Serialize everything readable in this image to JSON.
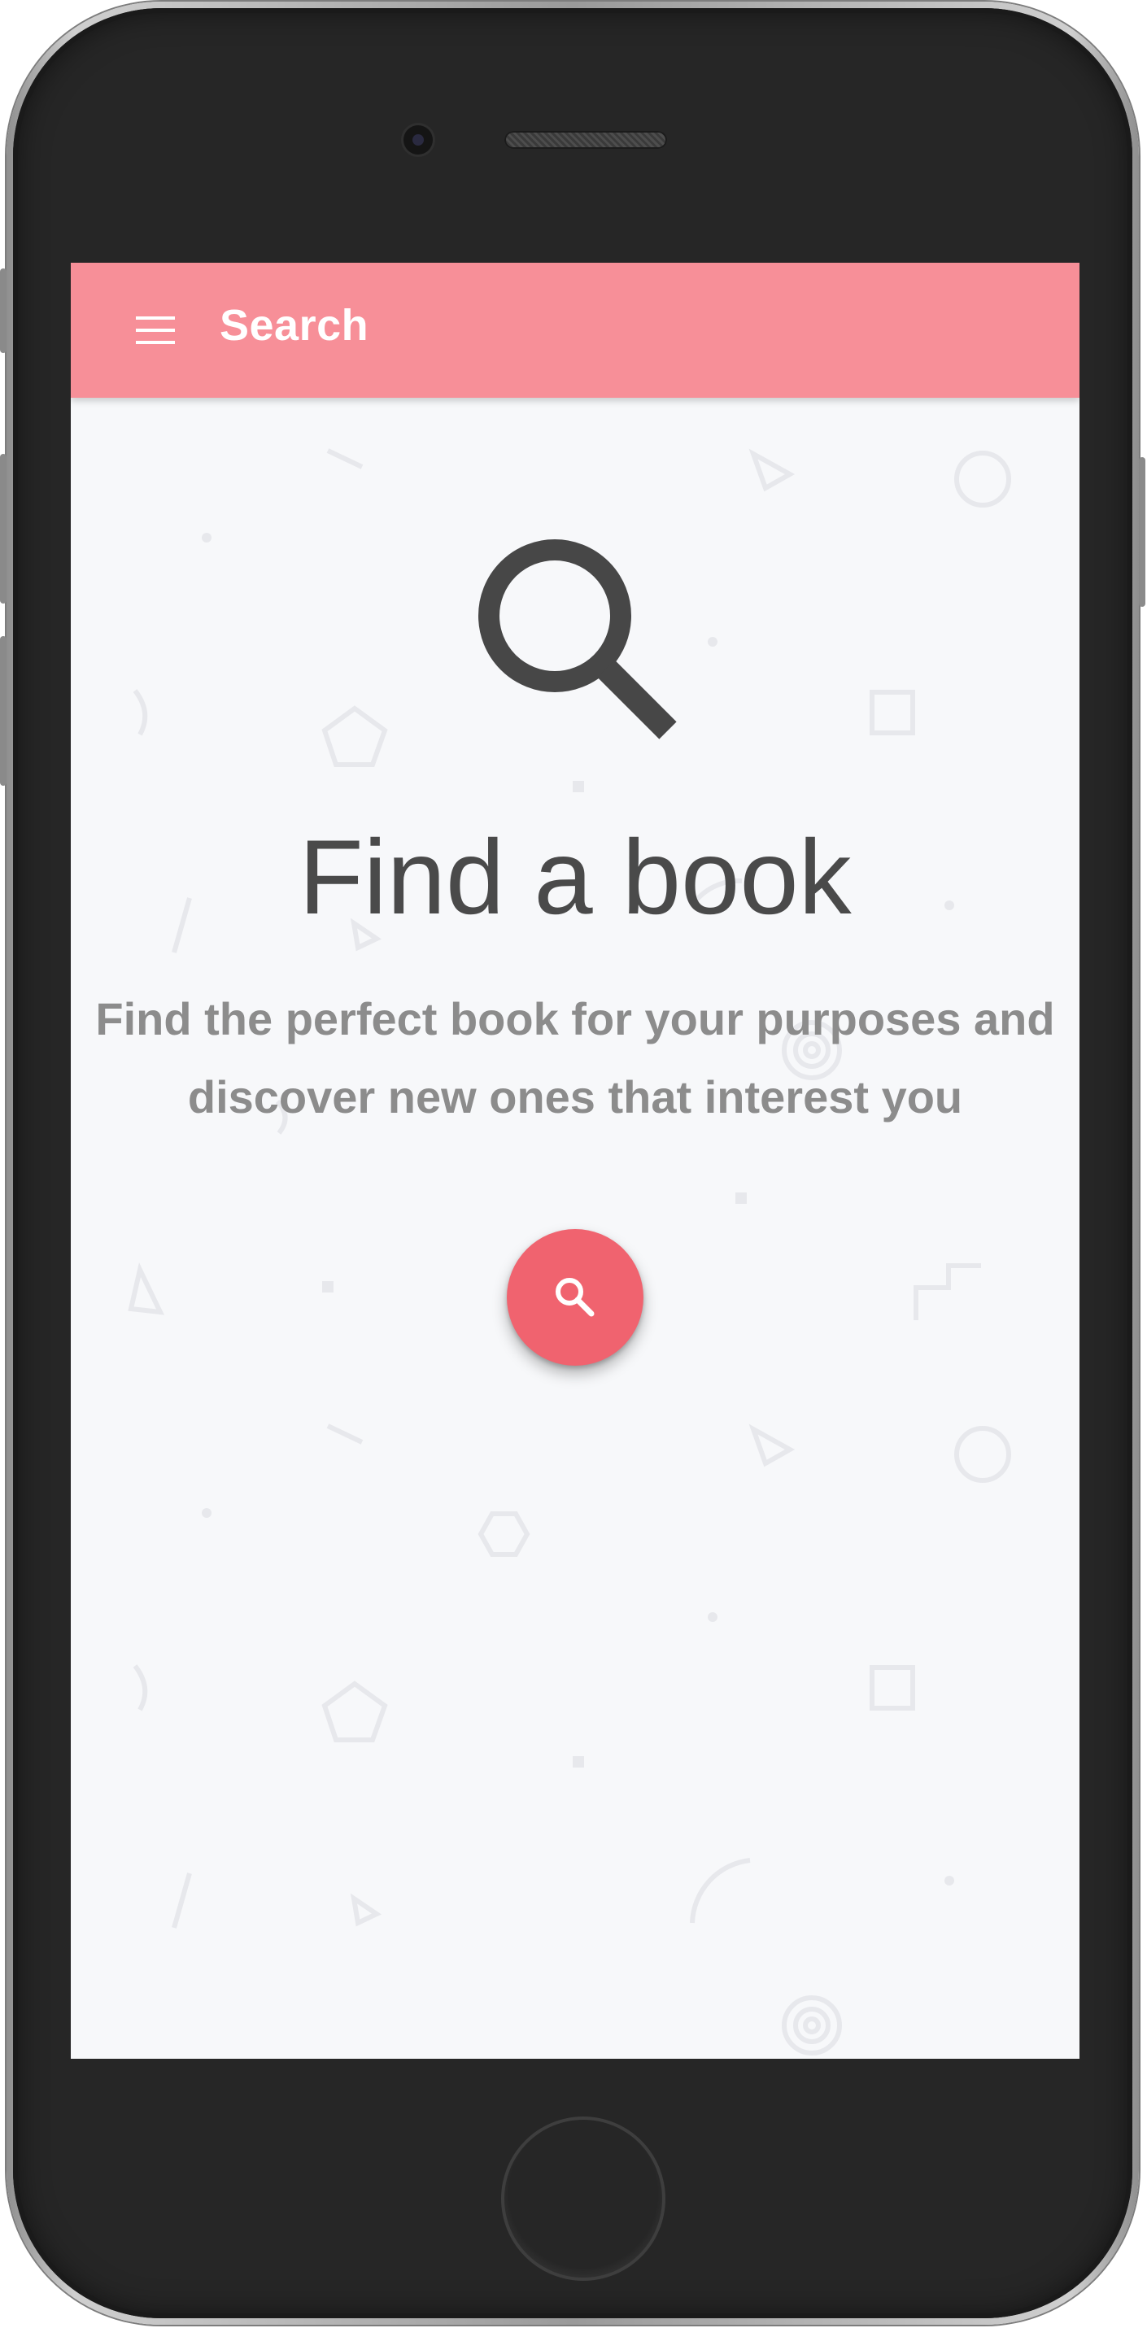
{
  "app": {
    "toolbar_title": "Search",
    "accent_color": "#f78f98",
    "fab_color": "#f0636f"
  },
  "icons": {
    "menu": "hamburger-menu-icon",
    "hero": "magnifier-icon",
    "fab": "search-icon"
  },
  "empty_state": {
    "title": "Find a book",
    "subtitle_line1": "Find the perfect book for your purposes and",
    "subtitle_line2": "discover new ones that interest you"
  }
}
